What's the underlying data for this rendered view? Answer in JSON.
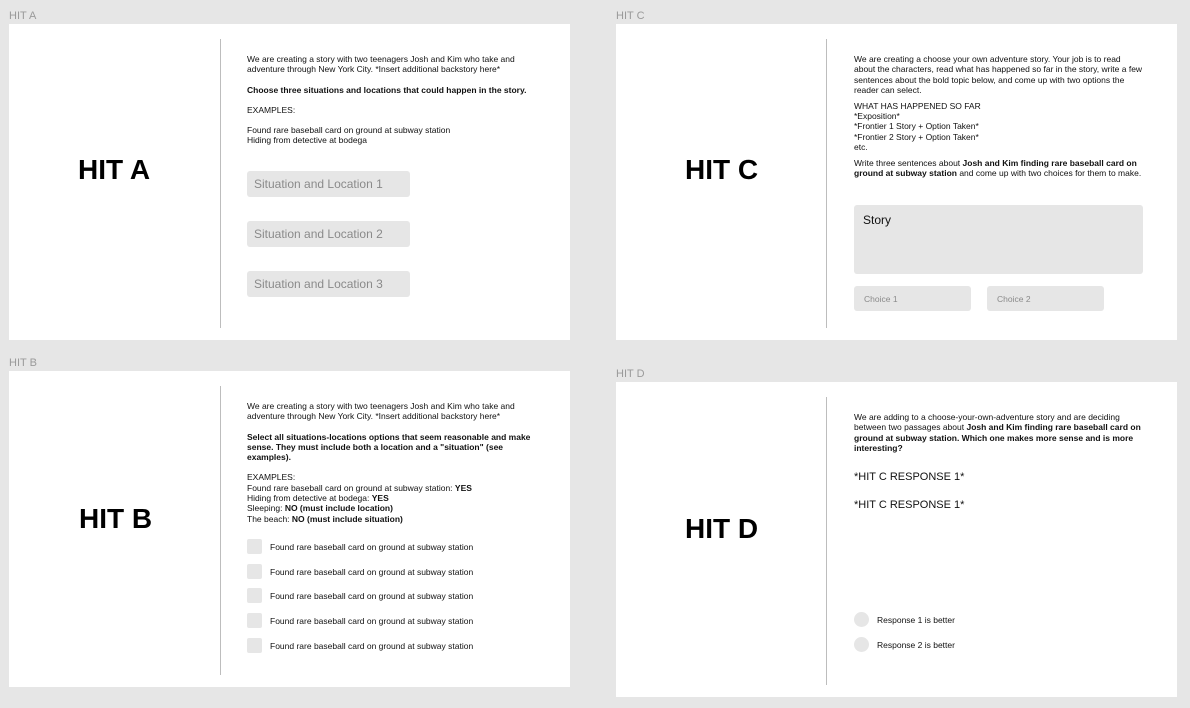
{
  "hit_a": {
    "frame_label": "HIT A",
    "title": "HIT A",
    "intro": "We are creating a story with two teenagers Josh and Kim who take and adventure through New York City. *Insert additional backstory here*",
    "instruction": "Choose three situations and locations that could happen in the story.",
    "examples_label": "EXAMPLES:",
    "example_1": "Found rare baseball card on ground at subway station",
    "example_2": "Hiding from detective at bodega",
    "inputs": [
      "Situation and Location 1",
      "Situation and Location 2",
      "Situation and Location 3"
    ]
  },
  "hit_b": {
    "frame_label": "HIT B",
    "title": "HIT B",
    "intro": "We are creating a story with two teenagers Josh and Kim who take and adventure through New York City. *Insert additional backstory here*",
    "instruction": "Select all situations-locations options that seem reasonable and make sense. They must include both a location and a \"situation\" (see examples).",
    "examples_label": "EXAMPLES:",
    "examples": [
      {
        "text": "Found rare baseball card on ground at subway station: ",
        "verdict": "YES"
      },
      {
        "text": "Hiding from detective at bodega: ",
        "verdict": "YES"
      },
      {
        "text": "Sleeping: ",
        "verdict": "NO (must include location)"
      },
      {
        "text": "The beach: ",
        "verdict": "NO (must include situation)"
      }
    ],
    "options": [
      "Found rare baseball card on ground at subway station",
      "Found rare baseball card on ground at subway station",
      "Found rare baseball card on ground at subway station",
      "Found rare baseball card on ground at subway station",
      "Found rare baseball card on ground at subway station"
    ]
  },
  "hit_c": {
    "frame_label": "HIT C",
    "title": "HIT C",
    "intro": "We are creating a choose your own adventure story. Your job is to read about the characters, read what has happened so far in the story, write a few sentences about the bold topic below, and come up with two options the reader can select.",
    "so_far_label": "WHAT HAS HAPPENED SO FAR",
    "so_far": [
      "*Exposition*",
      "*Frontier 1 Story + Option Taken*",
      "*Frontier 2 Story + Option Taken*",
      "etc."
    ],
    "write_prefix": "Write three sentences about ",
    "write_topic": "Josh and Kim finding rare baseball card on ground at subway station",
    "write_suffix": " and come up with two choices for them to make.",
    "story_placeholder": "Story",
    "choice_1": "Choice 1",
    "choice_2": "Choice 2"
  },
  "hit_d": {
    "frame_label": "HIT D",
    "title": "HIT D",
    "intro_prefix": "We are adding to a choose-your-own-adventure story and are deciding between two passages about ",
    "intro_topic": "Josh and Kim finding rare baseball card on ground at subway station",
    "intro_suffix": ". Which one makes more sense and is more interesting?",
    "response_1": "*HIT C RESPONSE 1*",
    "response_2": "*HIT C RESPONSE 1*",
    "radio_1": "Response 1 is better",
    "radio_2": "Response 2 is better"
  }
}
